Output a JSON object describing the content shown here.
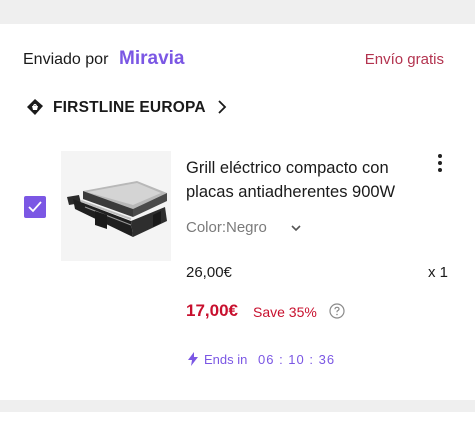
{
  "seller": {
    "sent_by_label": "Enviado por",
    "brand": "Miravia",
    "shipping": "Envío gratis"
  },
  "store": {
    "name": "FIRSTLINE EUROPA",
    "icon": "store-bag-icon"
  },
  "product": {
    "selected": true,
    "title": "Grill eléctrico compacto con placas antiadherentes 900W",
    "variant": "Color:Negro",
    "original_price": "26,00€",
    "quantity": "x 1",
    "sale_price": "17,00€",
    "discount": "Save 35%",
    "ends_label": "Ends in",
    "timer": "06 : 10 : 36"
  },
  "colors": {
    "brand_purple": "#7b57e4",
    "price_red": "#c8102e",
    "shipping_red": "#b3334f"
  }
}
